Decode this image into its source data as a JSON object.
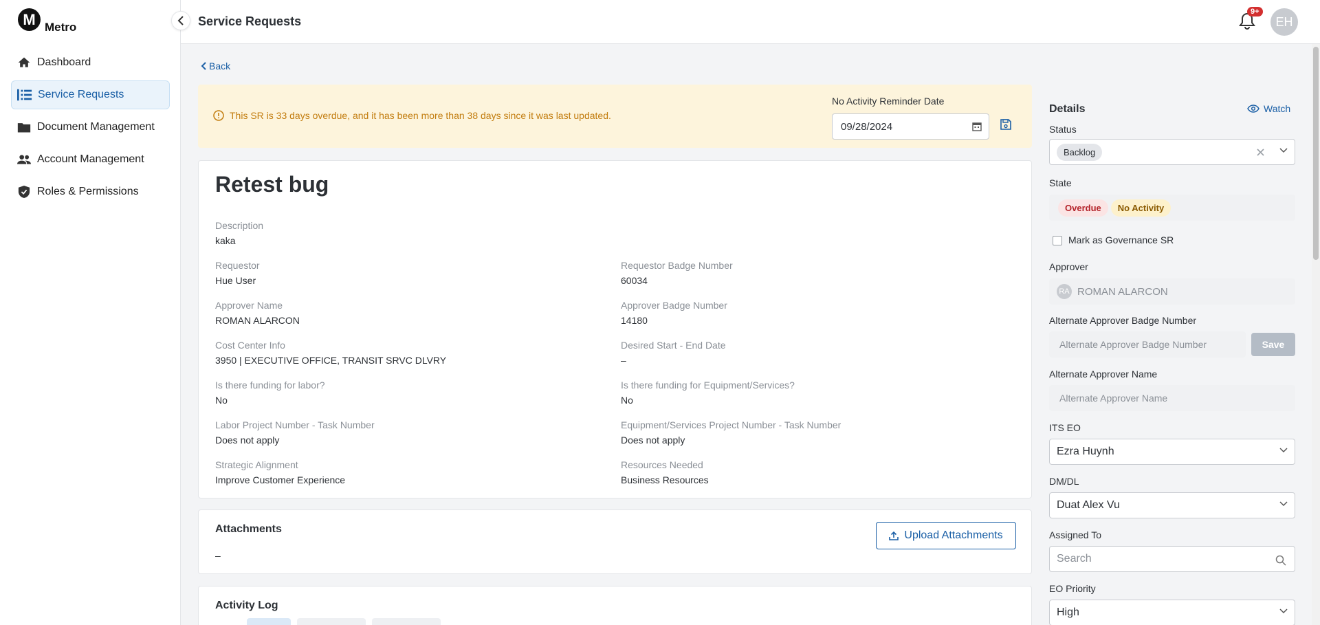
{
  "app": {
    "logo_letter": "M",
    "logo_text": "Metro"
  },
  "sidebar": {
    "items": [
      {
        "label": "Dashboard",
        "icon": "home-icon"
      },
      {
        "label": "Service Requests",
        "icon": "list-icon",
        "active": true
      },
      {
        "label": "Document Management",
        "icon": "folder-icon"
      },
      {
        "label": "Account Management",
        "icon": "people-icon"
      },
      {
        "label": "Roles & Permissions",
        "icon": "shield-icon"
      }
    ]
  },
  "header": {
    "title": "Service Requests",
    "notification_badge": "9+",
    "user_initials": "EH"
  },
  "back_label": "Back",
  "banner": {
    "message": "This SR is 33 days overdue, and it has been more than 38 days since it was last updated.",
    "reminder_label": "No Activity Reminder Date",
    "reminder_date": "09/28/2024"
  },
  "sr": {
    "title": "Retest bug",
    "fields": {
      "description": {
        "label": "Description",
        "value": "kaka"
      },
      "requestor": {
        "label": "Requestor",
        "value": "Hue User"
      },
      "requestor_badge": {
        "label": "Requestor Badge Number",
        "value": "60034"
      },
      "approver_name": {
        "label": "Approver Name",
        "value": "ROMAN ALARCON"
      },
      "approver_badge": {
        "label": "Approver Badge Number",
        "value": "14180"
      },
      "cost_center": {
        "label": "Cost Center Info",
        "value": "3950 | EXECUTIVE OFFICE, TRANSIT SRVC DLVRY"
      },
      "desired_dates": {
        "label": "Desired Start - End Date",
        "value": "–"
      },
      "funding_labor": {
        "label": "Is there funding for labor?",
        "value": "No"
      },
      "funding_equipment": {
        "label": "Is there funding for Equipment/Services?",
        "value": "No"
      },
      "labor_project": {
        "label": "Labor Project Number - Task Number",
        "value": "Does not apply"
      },
      "equipment_project": {
        "label": "Equipment/Services Project Number - Task Number",
        "value": "Does not apply"
      },
      "strategic_alignment": {
        "label": "Strategic Alignment",
        "value": "Improve Customer Experience"
      },
      "resources_needed": {
        "label": "Resources Needed",
        "value": "Business Resources"
      }
    }
  },
  "attachments": {
    "title": "Attachments",
    "upload_label": "Upload Attachments",
    "empty": "–"
  },
  "activity_log": {
    "title": "Activity Log"
  },
  "details": {
    "title": "Details",
    "watch_label": "Watch",
    "status_label": "Status",
    "status_value": "Backlog",
    "state_label": "State",
    "state_chips": [
      {
        "label": "Overdue",
        "bg": "#fbe4e4",
        "color": "#b4232a"
      },
      {
        "label": "No Activity",
        "bg": "#fdf1cc",
        "color": "#8a5a00"
      }
    ],
    "governance_label": "Mark as Governance SR",
    "approver_label": "Approver",
    "approver_initials": "RA",
    "approver_value": "ROMAN ALARCON",
    "alt_badge_label": "Alternate Approver Badge Number",
    "alt_badge_placeholder": "Alternate Approver Badge Number",
    "alt_badge_save": "Save",
    "alt_name_label": "Alternate Approver Name",
    "alt_name_placeholder": "Alternate Approver Name",
    "its_eo_label": "ITS EO",
    "its_eo_value": "Ezra Huynh",
    "dmdl_label": "DM/DL",
    "dmdl_value": "Duat Alex Vu",
    "assigned_label": "Assigned To",
    "assigned_placeholder": "Search",
    "priority_label": "EO Priority",
    "priority_value": "High"
  },
  "colors": {
    "accent": "#1a5fa6",
    "warning_bg": "#fdf4dc",
    "warning_text": "#c27c0e"
  }
}
